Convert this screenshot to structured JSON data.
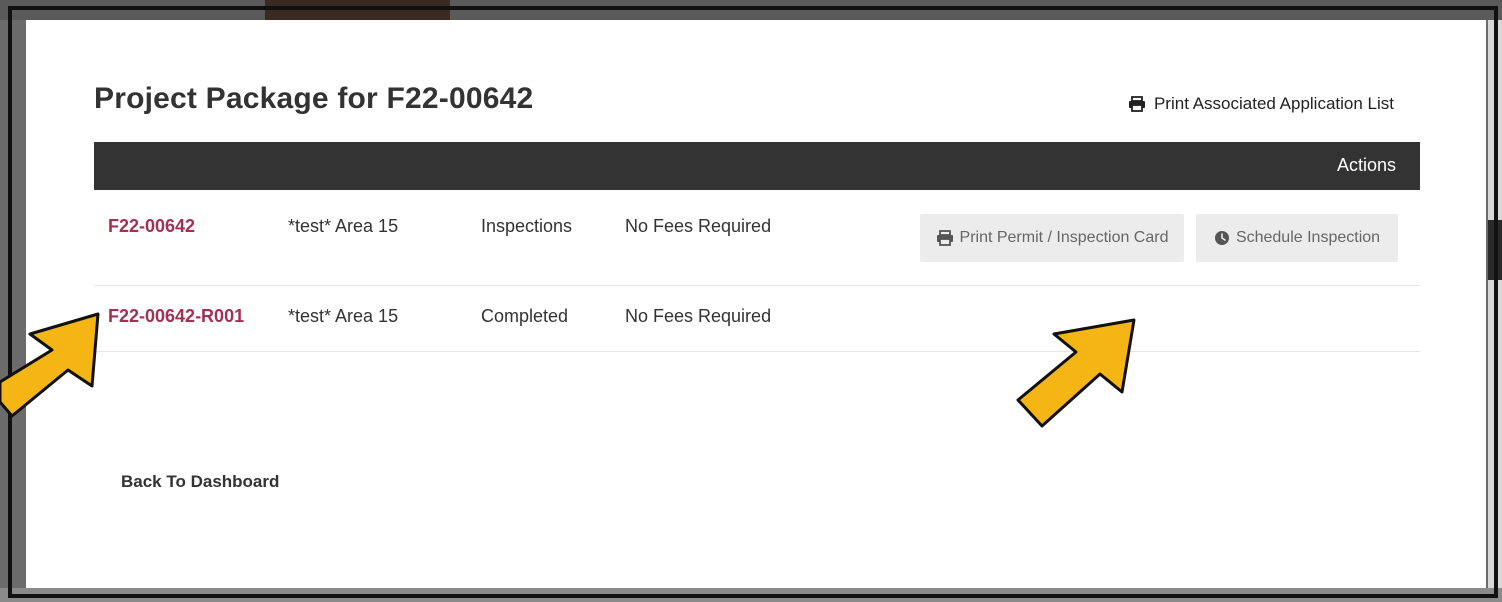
{
  "modal": {
    "title": "Project Package for F22-00642",
    "print_list_label": "Print Associated Application List",
    "print_list_icon": "printer-icon"
  },
  "table": {
    "header": {
      "actions_label": "Actions"
    },
    "rows": [
      {
        "id": "F22-00642",
        "area": "*test* Area 15",
        "status": "Inspections",
        "fees": "No Fees Required",
        "actions": [
          {
            "label": "Print Permit / Inspection Card",
            "icon": "printer-icon"
          },
          {
            "label": "Schedule Inspection",
            "icon": "clock-icon"
          }
        ]
      },
      {
        "id": "F22-00642-R001",
        "area": "*test* Area 15",
        "status": "Completed",
        "fees": "No Fees Required",
        "actions": []
      }
    ]
  },
  "footer": {
    "back_label": "Back To Dashboard"
  },
  "colors": {
    "link": "#a33152",
    "header_bg": "#333333",
    "button_bg": "#ececec",
    "arrow_fill": "#f5b514",
    "arrow_stroke": "#111111"
  }
}
